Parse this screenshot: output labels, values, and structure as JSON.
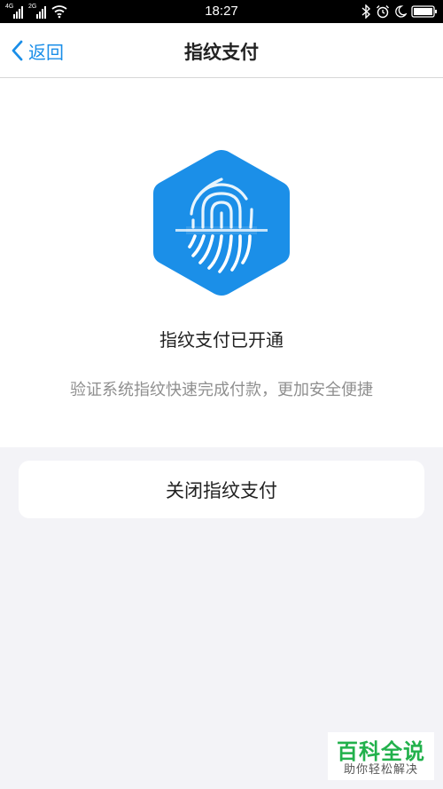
{
  "status_bar": {
    "time": "18:27",
    "signal1_label": "4G",
    "signal2_label": "2G",
    "icons": [
      "signal-icon",
      "signal-icon",
      "wifi-icon",
      "bluetooth-icon",
      "alarm-icon",
      "moon-icon",
      "battery-icon"
    ]
  },
  "nav": {
    "back_label": "返回",
    "title": "指纹支付"
  },
  "main": {
    "icon": "fingerprint-hexagon-icon",
    "status_title": "指纹支付已开通",
    "status_desc": "验证系统指纹快速完成付款，更加安全便捷"
  },
  "actions": {
    "close_label": "关闭指纹支付"
  },
  "watermark": {
    "main": "百科全说",
    "sub": "助你轻松解决"
  },
  "colors": {
    "accent": "#1a8ee8",
    "hexagon": "#1b8fe8",
    "background": "#f3f3f7",
    "watermark_green": "#22b14c"
  }
}
